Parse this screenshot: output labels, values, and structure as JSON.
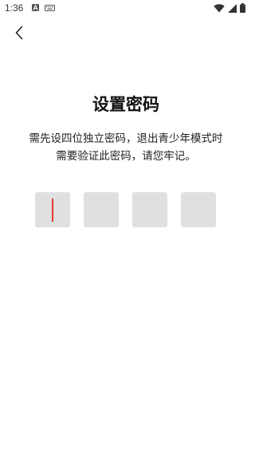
{
  "status_bar": {
    "time": "1:36",
    "left_icons": [
      "a-notification-icon",
      "keyboard-icon"
    ],
    "right_icons": [
      "wifi-icon",
      "signal-icon",
      "battery-icon"
    ]
  },
  "nav": {
    "back_icon": "chevron-left-icon"
  },
  "page": {
    "title": "设置密码",
    "description_line1": "需先设四位独立密码，退出青少年模式时",
    "description_line2": "需要验证此密码，请您牢记。"
  },
  "pin": {
    "length": 4,
    "filled": 0,
    "focused_index": 0,
    "caret_color": "#e53935",
    "box_color": "#e0e0e0"
  }
}
